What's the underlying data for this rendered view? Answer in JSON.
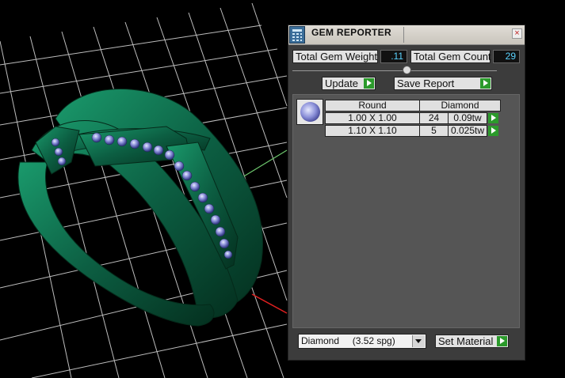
{
  "window": {
    "title": "GEM REPORTER",
    "close_icon": "×"
  },
  "totals": {
    "weight_label": "Total Gem Weight",
    "weight_value": ".11",
    "count_label": "Total Gem Count",
    "count_value": "29"
  },
  "buttons": {
    "update": "Update",
    "save_report": "Save Report",
    "set_material": "Set Material"
  },
  "table": {
    "headers": [
      "Round",
      "Diamond"
    ],
    "rows": [
      {
        "size": "1.00 X 1.00",
        "count": "24",
        "weight": "0.09tw"
      },
      {
        "size": "1.10 X 1.10",
        "count": "5",
        "weight": "0.025tw"
      }
    ]
  },
  "material": {
    "selected": "Diamond     (3.52 spg)"
  },
  "colors": {
    "ring": "#0e6b4a",
    "gem": "#8a8fd8",
    "grid": "#b8b8b8",
    "accent_green": "#2b9a2b"
  }
}
